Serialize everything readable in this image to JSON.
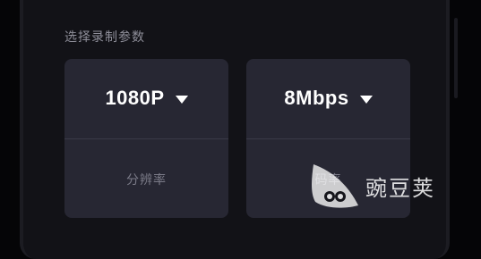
{
  "section_title": "选择录制参数",
  "resolution": {
    "value": "1080P",
    "label": "分辨率"
  },
  "bitrate": {
    "value": "8Mbps",
    "label": "码率"
  },
  "watermark": {
    "text": "豌豆荚"
  },
  "colors": {
    "card": "#272733",
    "background": "#121217",
    "text": "#ffffff",
    "muted": "#7b7b88"
  }
}
